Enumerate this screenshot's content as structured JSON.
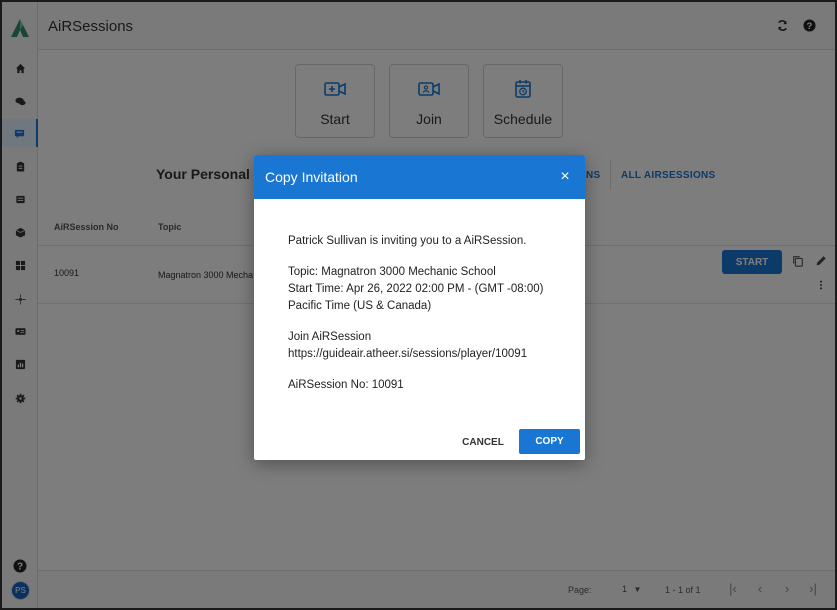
{
  "app": {
    "title": "AiRSessions"
  },
  "colors": {
    "accent": "#1976d2",
    "logo": "#2e8b6f",
    "overlay": "rgba(0,0,0,0.5)"
  },
  "sidebar": {
    "items": [
      {
        "icon": "home-icon"
      },
      {
        "icon": "chat-icon"
      },
      {
        "icon": "airsessions-icon",
        "active": true
      },
      {
        "icon": "clipboard-icon"
      },
      {
        "icon": "list-icon"
      },
      {
        "icon": "box-icon"
      },
      {
        "icon": "dashboard-icon"
      },
      {
        "icon": "network-icon"
      },
      {
        "icon": "id-card-icon"
      },
      {
        "icon": "chart-icon"
      },
      {
        "icon": "gear-icon"
      }
    ],
    "avatar_initials": "PS"
  },
  "actions": [
    {
      "label": "Start",
      "icon": "video-plus-icon"
    },
    {
      "label": "Join",
      "icon": "video-join-icon"
    },
    {
      "label": "Schedule",
      "icon": "calendar-clock-icon"
    }
  ],
  "section": {
    "title_visible": "Your Personal F",
    "tab_partial": "NS",
    "tab_all": "ALL AIRSESSIONS"
  },
  "table": {
    "headers": [
      "AiRSession No",
      "Topic"
    ],
    "rows": [
      {
        "number": "10091",
        "topic": "Magnatron 3000 Mecha",
        "start_label": "START"
      }
    ]
  },
  "footer": {
    "page_label": "Page:",
    "page_value": "1",
    "range": "1 - 1 of 1"
  },
  "modal": {
    "title": "Copy Invitation",
    "close": "×",
    "lines": [
      "Patrick Sullivan is inviting you to a AiRSession.",
      "",
      "Topic: Magnatron 3000 Mechanic School",
      "Start Time: Apr 26, 2022 02:00 PM - (GMT -08:00)",
      "Pacific Time (US & Canada)",
      "",
      "Join AiRSession",
      "https://guideair.atheer.si/sessions/player/10091",
      "",
      "AiRSession No: 10091"
    ],
    "cancel_label": "CANCEL",
    "copy_label": "COPY"
  }
}
